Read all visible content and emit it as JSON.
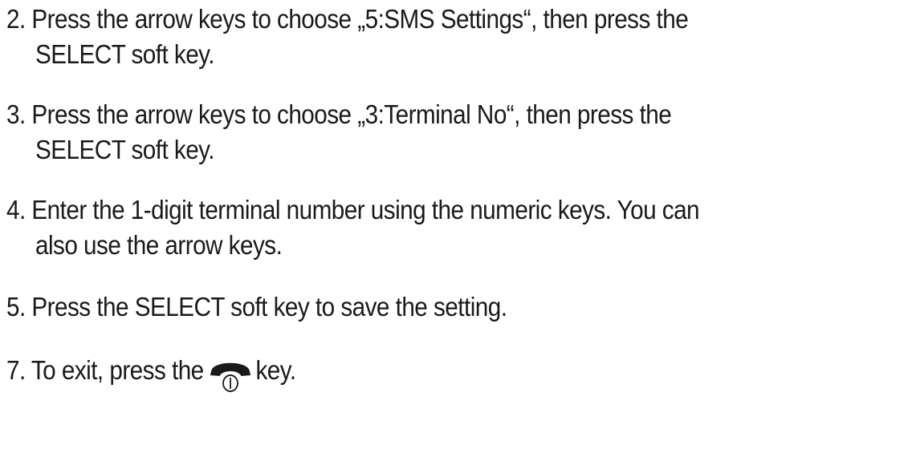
{
  "steps": [
    {
      "line1": "2. Press the arrow keys to choose „5:SMS Settings“, then press the",
      "line2": "SELECT soft key."
    },
    {
      "line1": "3. Press the arrow keys to choose „3:Terminal No“, then press the",
      "line2": "SELECT soft key."
    },
    {
      "line1": "4. Enter the 1-digit terminal number using the numeric keys. You can",
      "line2": "also use the arrow keys."
    },
    {
      "line1": "5. Press the SELECT soft key to save the setting."
    },
    {
      "before": "7. To exit, press the",
      "icon": "end-call-icon",
      "after": "key."
    }
  ]
}
